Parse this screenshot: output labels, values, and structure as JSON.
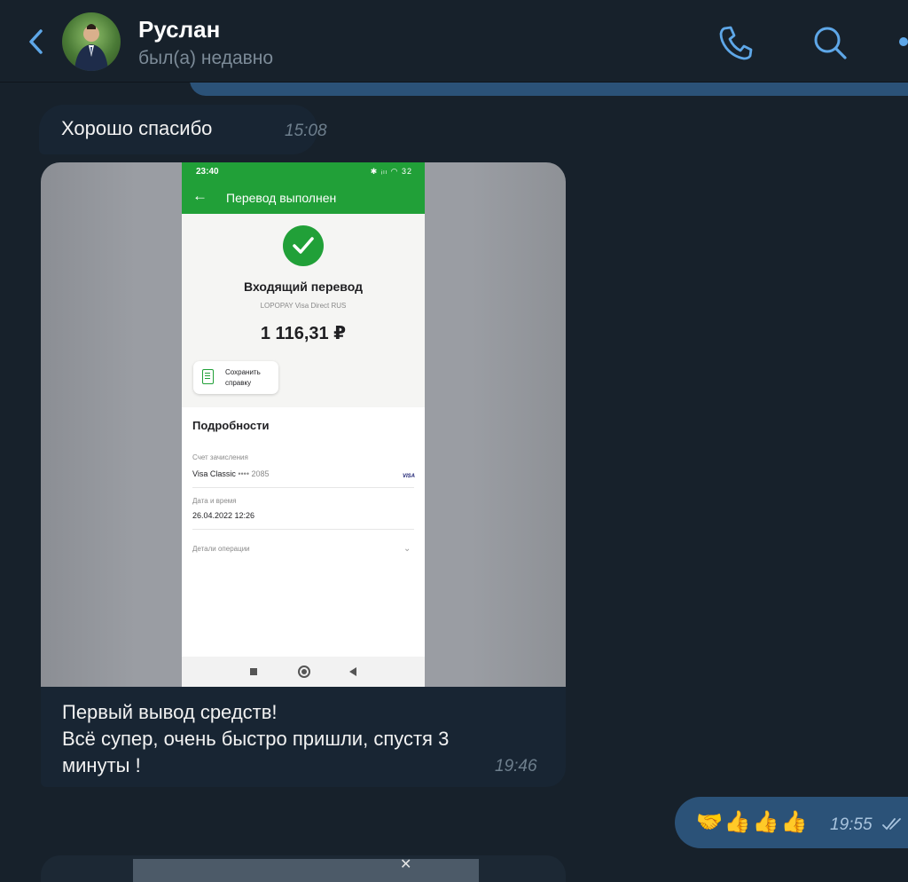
{
  "header": {
    "contact_name": "Руслан",
    "status": "был(а) недавно",
    "icons": [
      "back-arrow-icon",
      "phone-icon",
      "search-icon",
      "more-icon"
    ],
    "accent_color": "#5ea7e8"
  },
  "messages": {
    "m1": {
      "text": "Хорошо спасибо",
      "time": "15:08"
    },
    "m2": {
      "screenshot": {
        "status_time": "23:40",
        "status_icons": "✱ ᵢₗₗ ◠ 32",
        "title": "Перевод выполнен",
        "heading": "Входящий перевод",
        "merchant": "LOPOPAY Visa Direct RUS",
        "amount": "1 116,31 ₽",
        "save_label": "Сохранить\nсправку",
        "details_title": "Подробности",
        "account_label": "Счет зачисления",
        "account_value": "Visa Classic",
        "account_mask": "•••• 2085",
        "card_brand": "VISA",
        "date_label": "Дата и время",
        "date_value": "26.04.2022 12:26",
        "ops_label": "Детали операции",
        "accent_color": "#21a038"
      },
      "caption": {
        "line1": "Первый вывод средств!",
        "line2": "Всё супер, очень быстро пришли, спустя 3",
        "line3": "минуты !"
      },
      "time": "19:46"
    },
    "m3": {
      "emojis": "🤝👍👍👍",
      "time": "19:55",
      "read": true
    }
  },
  "colors": {
    "background": "#17212b",
    "incoming_bubble": "#182533",
    "outgoing_bubble": "#2b5278"
  }
}
